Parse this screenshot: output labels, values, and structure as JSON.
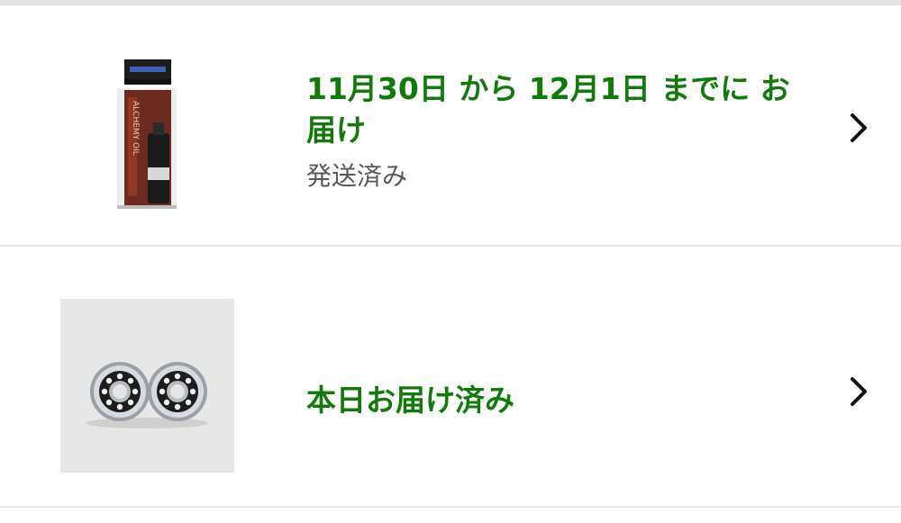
{
  "orders": [
    {
      "status": "11月30日 から 12月1日 までに お届け",
      "substatus": "発送済み",
      "product_icon": "oil-bottle-package-image",
      "product_label": "ALCHEMY OIL",
      "chevron_icon": "chevron-right-icon"
    },
    {
      "status": "本日お届け済み",
      "product_icon": "ball-bearings-image",
      "chevron_icon": "chevron-right-icon"
    }
  ],
  "colors": {
    "status_green": "#117a0b",
    "substatus_gray": "#565959",
    "divider": "#e3e6e6"
  }
}
